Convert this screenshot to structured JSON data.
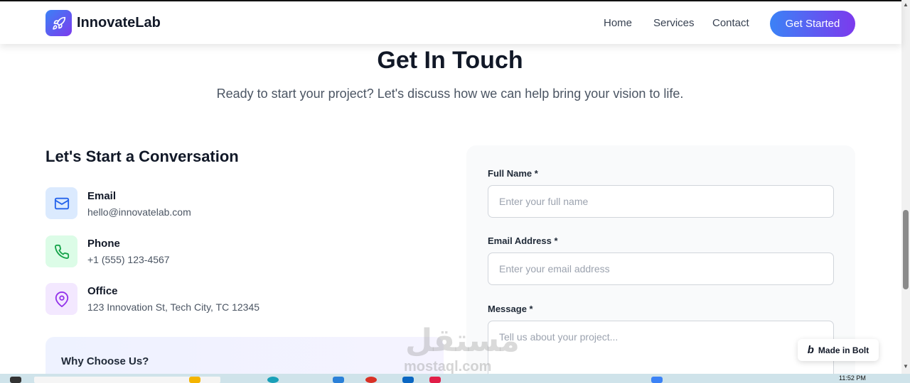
{
  "header": {
    "brand": "InnovateLab",
    "nav": [
      "Home",
      "Services",
      "Contact"
    ],
    "cta": "Get Started"
  },
  "hero": {
    "title": "Get In Touch",
    "subtitle": "Ready to start your project? Let's discuss how we can help bring your vision to life."
  },
  "contact": {
    "heading": "Let's Start a Conversation",
    "items": [
      {
        "label": "Email",
        "value": "hello@innovatelab.com",
        "icon": "mail-icon",
        "bg": "#dbeafe",
        "color": "#2563eb"
      },
      {
        "label": "Phone",
        "value": "+1 (555) 123-4567",
        "icon": "phone-icon",
        "bg": "#dcfce7",
        "color": "#16a34a"
      },
      {
        "label": "Office",
        "value": "123 Innovation St, Tech City, TC 12345",
        "icon": "map-pin-icon",
        "bg": "#f3e8ff",
        "color": "#9333ea"
      }
    ],
    "why_title": "Why Choose Us?"
  },
  "form": {
    "name_label": "Full Name *",
    "name_placeholder": "Enter your full name",
    "email_label": "Email Address *",
    "email_placeholder": "Enter your email address",
    "message_label": "Message *",
    "message_placeholder": "Tell us about your project..."
  },
  "badge": {
    "label": "Made in Bolt",
    "logo": "b"
  },
  "watermark": {
    "arabic": "مستقل",
    "latin": "mostaql.com"
  },
  "taskbar": {
    "time": "11:52 PM"
  },
  "colors": {
    "accent_start": "#3b82f6",
    "accent_end": "#7c3aed"
  }
}
